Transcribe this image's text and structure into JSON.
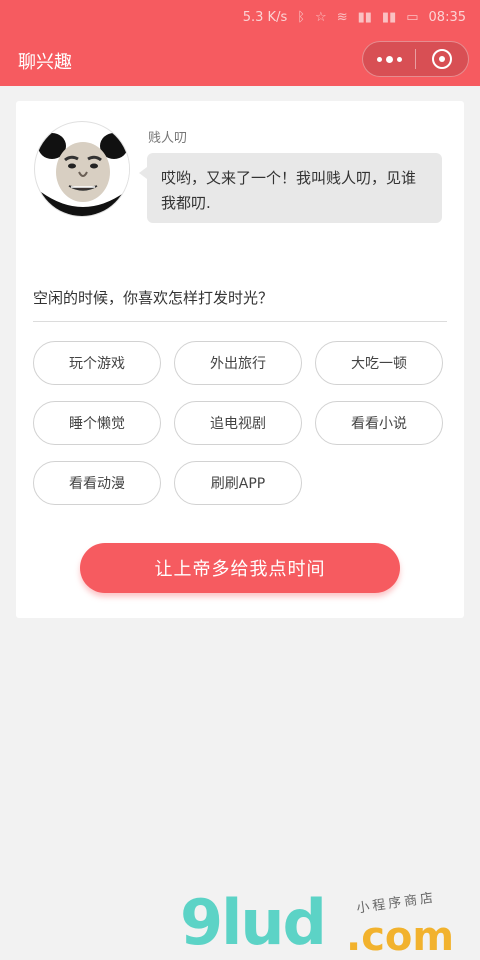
{
  "status_bar": {
    "speed": "5.3 K/s",
    "time": "08:35"
  },
  "nav": {
    "title": "聊兴趣"
  },
  "chat": {
    "bot_name": "贱人叨",
    "message": "哎哟，又来了一个！我叫贱人叨，见谁我都叨."
  },
  "question": "空闲的时候，你喜欢怎样打发时光？",
  "options": [
    "玩个游戏",
    "外出旅行",
    "大吃一顿",
    "睡个懒觉",
    "追电视剧",
    "看看小说",
    "看看动漫",
    "刷刷APP"
  ],
  "cta_label": "让上帝多给我点时间",
  "watermark": {
    "logo": "9lud",
    "domain": ".com",
    "tagline": "小程序商店"
  },
  "colors": {
    "brand": "#f65b60",
    "card": "#ffffff",
    "background": "#f2f2f2"
  }
}
